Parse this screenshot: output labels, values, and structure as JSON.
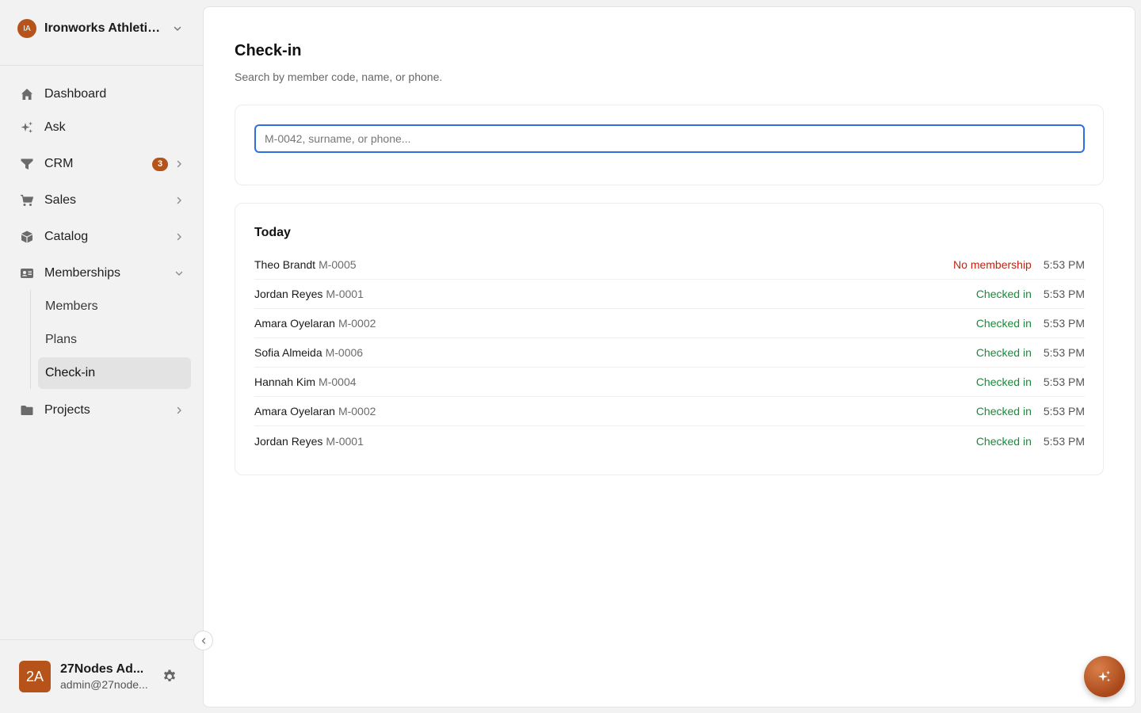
{
  "org": {
    "initials": "IA",
    "name": "Ironworks Athletic..."
  },
  "nav": {
    "dashboard": "Dashboard",
    "ask": "Ask",
    "crm": "CRM",
    "crm_badge": "3",
    "sales": "Sales",
    "catalog": "Catalog",
    "memberships": "Memberships",
    "members": "Members",
    "plans": "Plans",
    "checkin": "Check-in",
    "projects": "Projects"
  },
  "user": {
    "initials": "2A",
    "name": "27Nodes Ad...",
    "email": "admin@27node..."
  },
  "page": {
    "title": "Check-in",
    "subtitle": "Search by member code, name, or phone."
  },
  "search": {
    "placeholder": "M-0042, surname, or phone...",
    "value": ""
  },
  "today": {
    "title": "Today",
    "rows": [
      {
        "name": "Theo Brandt",
        "code": "M-0005",
        "status": "No membership",
        "status_type": "error",
        "time": "5:53 PM"
      },
      {
        "name": "Jordan Reyes",
        "code": "M-0001",
        "status": "Checked in",
        "status_type": "success",
        "time": "5:53 PM"
      },
      {
        "name": "Amara Oyelaran",
        "code": "M-0002",
        "status": "Checked in",
        "status_type": "success",
        "time": "5:53 PM"
      },
      {
        "name": "Sofia Almeida",
        "code": "M-0006",
        "status": "Checked in",
        "status_type": "success",
        "time": "5:53 PM"
      },
      {
        "name": "Hannah Kim",
        "code": "M-0004",
        "status": "Checked in",
        "status_type": "success",
        "time": "5:53 PM"
      },
      {
        "name": "Amara Oyelaran",
        "code": "M-0002",
        "status": "Checked in",
        "status_type": "success",
        "time": "5:53 PM"
      },
      {
        "name": "Jordan Reyes",
        "code": "M-0001",
        "status": "Checked in",
        "status_type": "success",
        "time": "5:53 PM"
      }
    ]
  },
  "colors": {
    "accent": "#b5531b",
    "focus": "#2f6fe0",
    "success": "#1a8a3a",
    "error": "#c0230f"
  }
}
